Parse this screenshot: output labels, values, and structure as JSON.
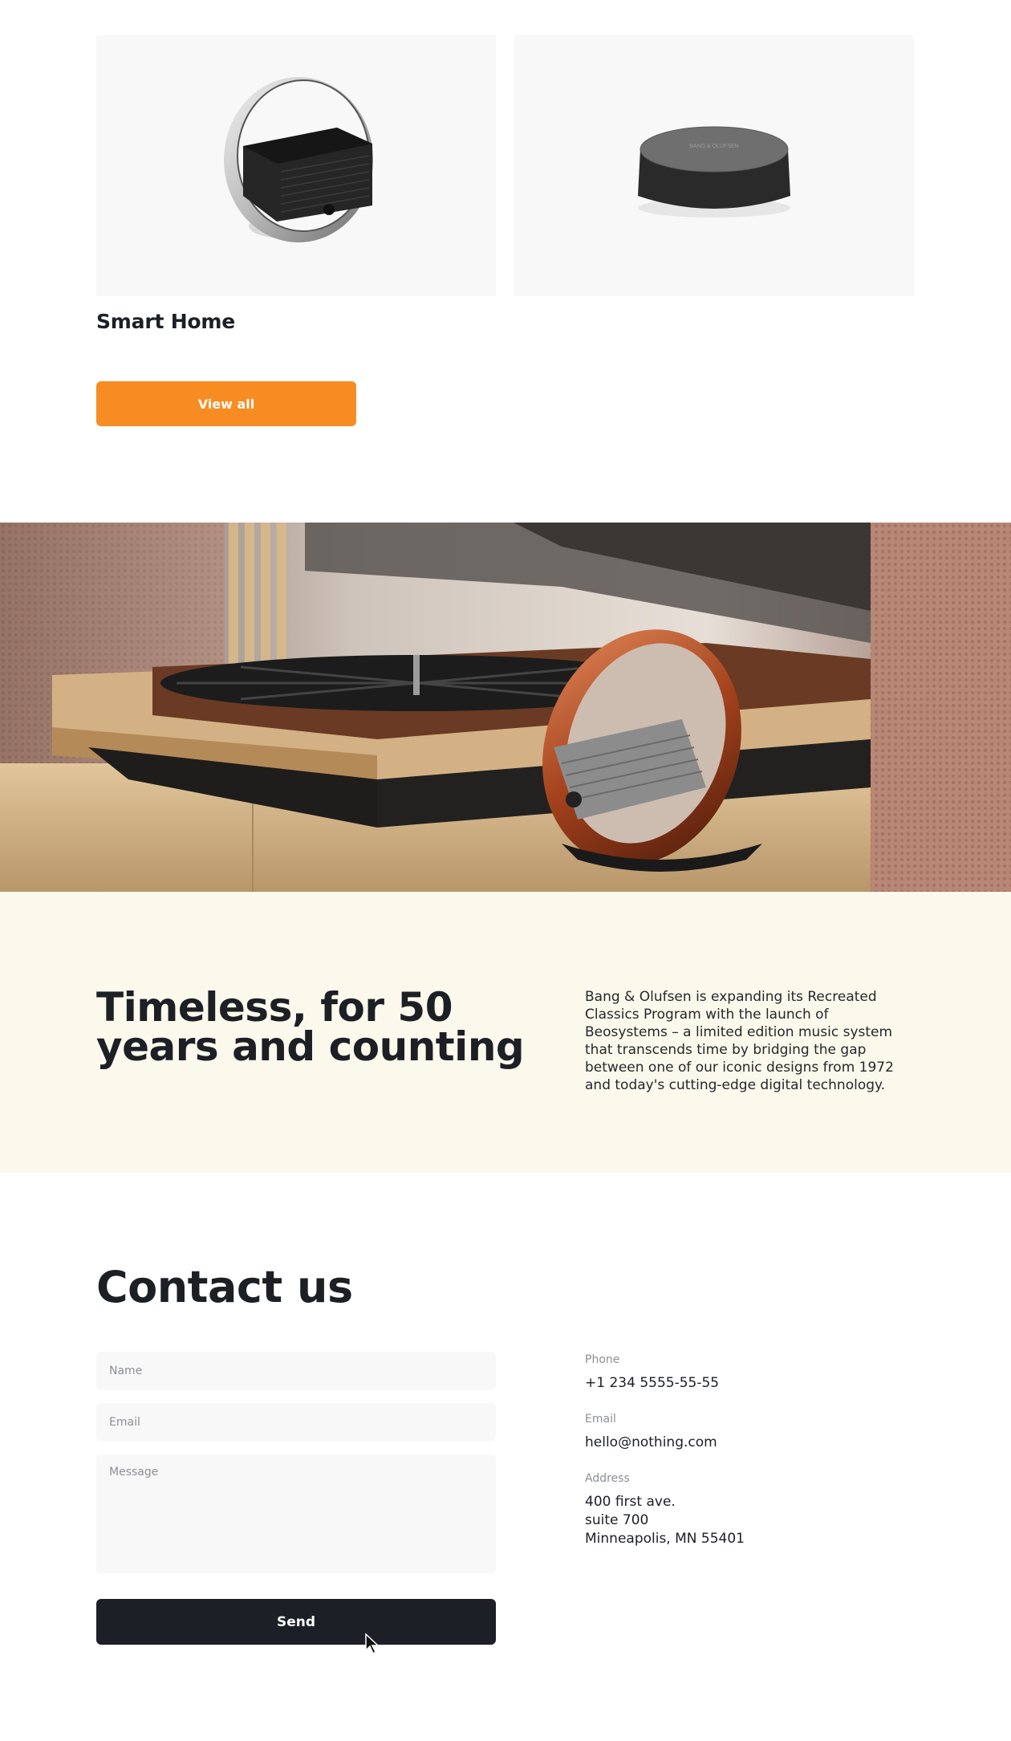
{
  "products": {
    "category_title": "Smart Home",
    "view_all_label": "View all",
    "card2_logo_text": "BANG & OLUFSEN"
  },
  "story": {
    "heading_line1": "Timeless, for 50",
    "heading_line2": "years and counting",
    "text": "Bang & Olufsen is expanding its Recreated Classics Program with the launch of Beosystems – a limited edition music system that transcends time by bridging the gap between one of our iconic designs from 1972 and today's cutting-edge digital technology."
  },
  "contact": {
    "title": "Contact us",
    "name_placeholder": "Name",
    "email_placeholder": "Email",
    "message_placeholder": "Message",
    "send_label": "Send",
    "phone_label": "Phone",
    "phone_value": "+1 234 5555-55-55",
    "email_label": "Email",
    "email_value": "hello@nothing.com",
    "address_label": "Address",
    "address_line1": "400 first ave.",
    "address_line2": "suite 700",
    "address_line3": "Minneapolis, MN 55401"
  },
  "colors": {
    "accent": "#f78c22",
    "dark": "#1c1f26",
    "cream": "#fbf8ec",
    "card_bg": "#f8f8f8"
  },
  "icons": [
    "cursor-arrow-icon"
  ]
}
